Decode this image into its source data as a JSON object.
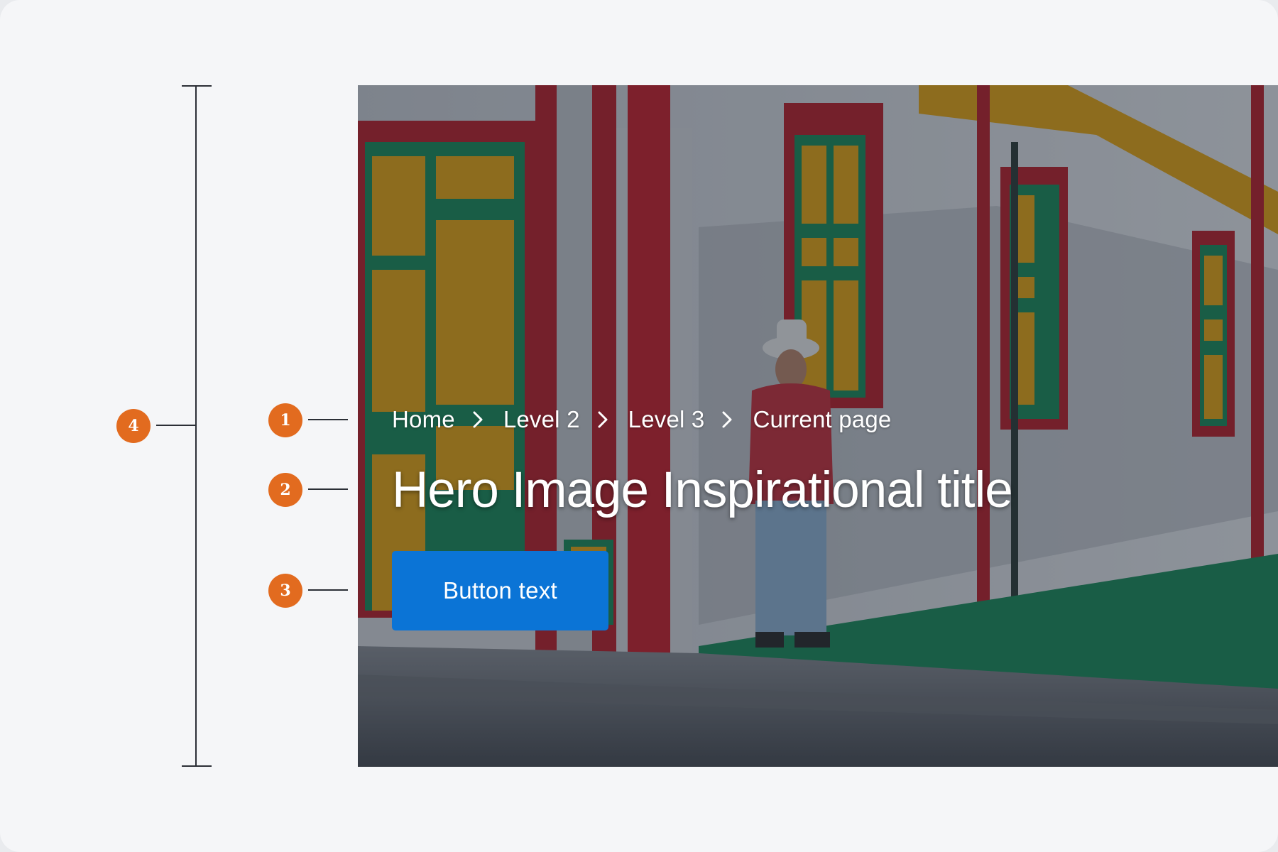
{
  "breadcrumb": {
    "items": [
      "Home",
      "Level 2",
      "Level 3",
      "Current page"
    ]
  },
  "hero": {
    "title": "Hero Image Inspirational title",
    "button_label": "Button text"
  },
  "callouts": [
    "1",
    "2",
    "3",
    "4"
  ],
  "colors": {
    "callout": "#e26b1f",
    "button": "#0b74d6",
    "background": "#f5f6f8"
  }
}
